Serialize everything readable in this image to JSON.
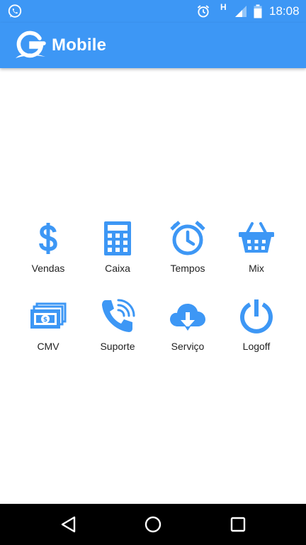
{
  "status_bar": {
    "time": "18:08",
    "network_type": "H",
    "icons": [
      "whatsapp-icon",
      "alarm-icon",
      "signal-icon",
      "battery-icon"
    ]
  },
  "app_bar": {
    "title": "Mobile",
    "logo": "g-logo"
  },
  "menu": {
    "items": [
      {
        "label": "Vendas",
        "icon": "dollar-icon"
      },
      {
        "label": "Caixa",
        "icon": "calculator-icon"
      },
      {
        "label": "Tempos",
        "icon": "alarm-clock-icon"
      },
      {
        "label": "Mix",
        "icon": "basket-icon"
      },
      {
        "label": "CMV",
        "icon": "money-stack-icon"
      },
      {
        "label": "Suporte",
        "icon": "phone-icon"
      },
      {
        "label": "Serviço",
        "icon": "cloud-download-icon"
      },
      {
        "label": "Logoff",
        "icon": "power-icon"
      }
    ]
  },
  "nav_bar": {
    "buttons": [
      "back-icon",
      "home-icon",
      "recents-icon"
    ]
  },
  "colors": {
    "primary": "#3d97f5",
    "icon": "#3d97f5",
    "label": "#222222",
    "nav_bar": "#000000"
  }
}
